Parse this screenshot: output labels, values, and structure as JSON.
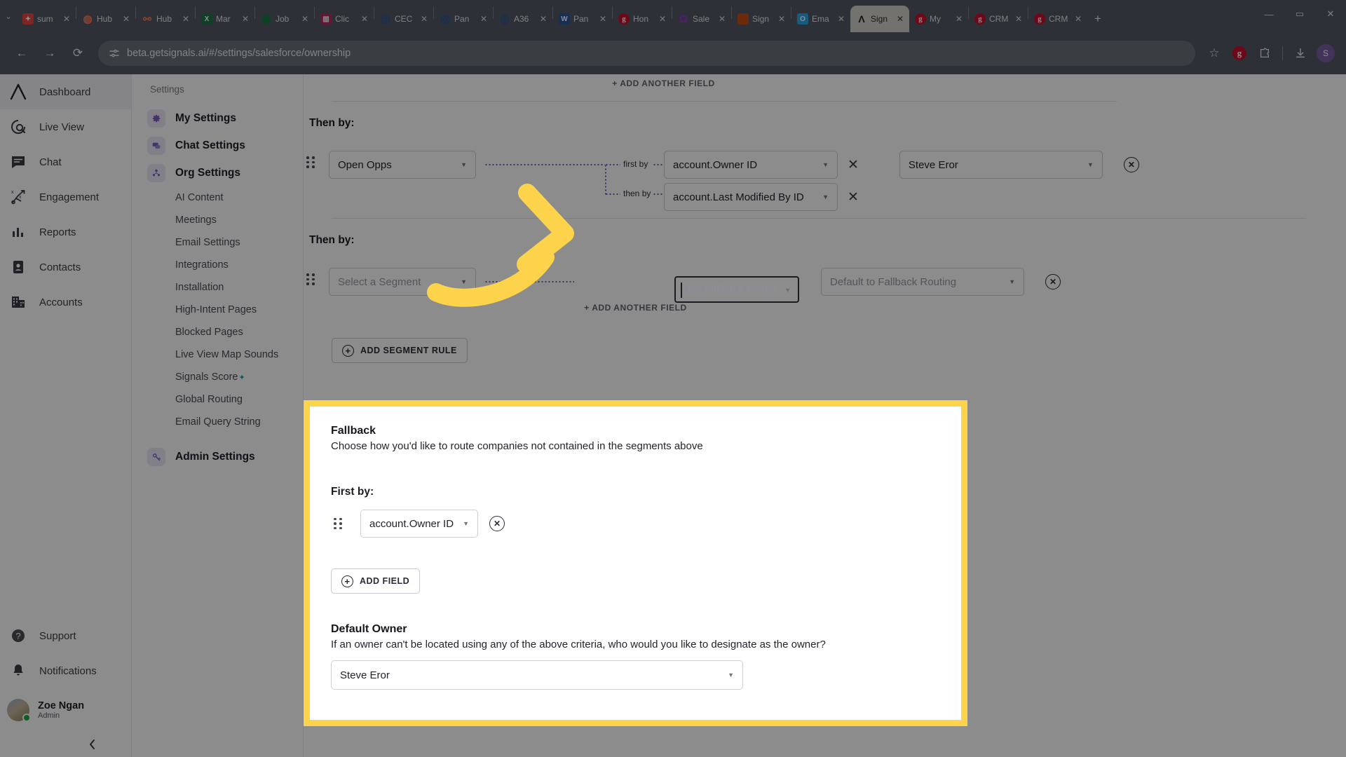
{
  "browser": {
    "tabs": [
      {
        "label": "sum",
        "icon": "slack-icon",
        "color": "#e8463f",
        "glyph": "✦",
        "active": false
      },
      {
        "label": "Hub",
        "icon": "hubspot-icon",
        "color": "#ff7a59",
        "glyph": "◕",
        "active": false
      },
      {
        "label": "Hub",
        "icon": "hubspot-icon",
        "color": "#ffffff",
        "glyph": "⚯",
        "active": false
      },
      {
        "label": "Mar",
        "icon": "excel-icon",
        "color": "#1e7145",
        "glyph": "X",
        "active": false
      },
      {
        "label": "Job",
        "icon": "teams-icon",
        "color": "#0f7b3f",
        "glyph": "◉",
        "active": false
      },
      {
        "label": "Clic",
        "icon": "clickup-icon",
        "color": "#b32d5e",
        "glyph": "▥",
        "active": false
      },
      {
        "label": "CEC",
        "icon": "word-icon",
        "color": "#2b579a",
        "glyph": "◎",
        "active": false
      },
      {
        "label": "Pan",
        "icon": "word-icon",
        "color": "#2b579a",
        "glyph": "◎",
        "active": false
      },
      {
        "label": "A36",
        "icon": "word-icon",
        "color": "#2b579a",
        "glyph": "W",
        "active": false
      },
      {
        "label": "Pan",
        "icon": "word-icon",
        "color": "#2b579a",
        "glyph": "W",
        "active": false
      },
      {
        "label": "Hon",
        "icon": "gong-icon",
        "color": "#c8102e",
        "glyph": "g",
        "active": false
      },
      {
        "label": "Sale",
        "icon": "salesloft-icon",
        "color": "#9b30d9",
        "glyph": "O",
        "active": false
      },
      {
        "label": "Sign",
        "icon": "signals-orange-icon",
        "color": "#c44d12",
        "glyph": "",
        "active": false
      },
      {
        "label": "Ema",
        "icon": "outlook-icon",
        "color": "#28a8ea",
        "glyph": "O",
        "active": false
      },
      {
        "label": "Sign",
        "icon": "signals-icon",
        "color": "#2b2b2b",
        "glyph": "Λ",
        "active": true
      },
      {
        "label": "My",
        "icon": "gong-icon",
        "color": "#c8102e",
        "glyph": "g",
        "active": false
      },
      {
        "label": "CRM",
        "icon": "gong-icon",
        "color": "#c8102e",
        "glyph": "g",
        "active": false
      },
      {
        "label": "CRM",
        "icon": "gong-icon",
        "color": "#c8102e",
        "glyph": "g",
        "active": false
      }
    ],
    "new_tab_label": "+",
    "url": "beta.getsignals.ai/#/settings/salesforce/ownership",
    "back_icon": "back-arrow-icon",
    "forward_icon": "forward-arrow-icon",
    "reload_icon": "reload-icon",
    "site_settings_icon": "tune-icon",
    "bookmark_icon": "star-icon",
    "extension_gong_icon": "gong-extension-icon",
    "extensions_icon": "puzzle-icon",
    "downloads_icon": "download-icon",
    "profile_initial": "S",
    "window_minimize": "—",
    "window_maximize": "▭",
    "window_close": "✕"
  },
  "rail": {
    "items": [
      {
        "label": "Dashboard",
        "icon": "signals-logo-icon",
        "active": true
      },
      {
        "label": "Live View",
        "icon": "live-view-icon",
        "active": false
      },
      {
        "label": "Chat",
        "icon": "chat-icon",
        "active": false
      },
      {
        "label": "Engagement",
        "icon": "engagement-icon",
        "active": false
      },
      {
        "label": "Reports",
        "icon": "reports-icon",
        "active": false
      },
      {
        "label": "Contacts",
        "icon": "contacts-icon",
        "active": false
      },
      {
        "label": "Accounts",
        "icon": "accounts-icon",
        "active": false
      }
    ],
    "support": {
      "label": "Support",
      "icon": "help-circle-icon"
    },
    "notifications": {
      "label": "Notifications",
      "icon": "bell-icon"
    },
    "user": {
      "name": "Zoe Ngan",
      "role": "Admin",
      "status": "online"
    },
    "collapse_icon": "chevron-left-icon"
  },
  "settings_nav": {
    "title": "Settings",
    "top_items": [
      {
        "label": "My Settings",
        "icon": "gear-icon"
      },
      {
        "label": "Chat Settings",
        "icon": "chat-bubbles-icon"
      },
      {
        "label": "Org Settings",
        "icon": "org-people-icon"
      }
    ],
    "sub_items": [
      {
        "label": "AI Content",
        "badge": ""
      },
      {
        "label": "Meetings",
        "badge": ""
      },
      {
        "label": "Email Settings",
        "badge": ""
      },
      {
        "label": "Integrations",
        "badge": ""
      },
      {
        "label": "Installation",
        "badge": ""
      },
      {
        "label": "High-Intent Pages",
        "badge": ""
      },
      {
        "label": "Blocked Pages",
        "badge": ""
      },
      {
        "label": "Live View Map Sounds",
        "badge": ""
      },
      {
        "label": "Signals Score",
        "badge": "✦"
      },
      {
        "label": "Global Routing",
        "badge": ""
      },
      {
        "label": "Email Query String",
        "badge": ""
      }
    ],
    "admin": {
      "label": "Admin Settings",
      "icon": "admin-key-icon"
    }
  },
  "main": {
    "top_add_field_link": "+ ADD ANOTHER FIELD",
    "rule_one": {
      "then_by_label": "Then by:",
      "segment_value": "Open Opps",
      "first_by_label": "first by",
      "first_by_value": "account.Owner ID",
      "then_by_inner_label": "then by",
      "then_by_value": "account.Last Modified By ID",
      "assign_value": "Steve Eror",
      "remove_field_label": "✕",
      "remove_rule_label": "✕"
    },
    "rule_two": {
      "then_by_label": "Then by:",
      "segment_placeholder": "Select a Segment",
      "owner_placeholder": "Use Fallback Owner",
      "assign_placeholder": "Default to Fallback Routing",
      "add_field_link": "+ ADD ANOTHER FIELD",
      "remove_rule_label": "✕"
    },
    "add_segment_rule_button": "ADD SEGMENT RULE"
  },
  "fallback": {
    "heading": "Fallback",
    "description": "Choose how you'd like to route companies not contained in the segments above",
    "first_by_label": "First by:",
    "first_by_value": "account.Owner ID",
    "remove_icon_label": "✕",
    "add_field_button": "ADD FIELD",
    "default_owner_heading": "Default Owner",
    "default_owner_description": "If an owner can't be located using any of the above criteria, who would you like to designate as the owner?",
    "default_owner_value": "Steve Eror"
  },
  "colors": {
    "highlight": "#fcd34b",
    "accent_purple": "#6b4fbb",
    "chrome": "#525965"
  }
}
